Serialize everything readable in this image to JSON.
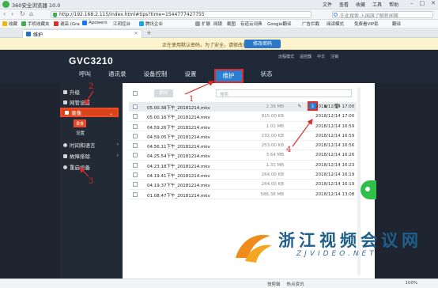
{
  "browser": {
    "title": "360安全浏览器 10.0",
    "menus": [
      "文件",
      "查看",
      "收藏",
      "工具",
      "帮助"
    ],
    "url": "http://192.168.2.115/index.html#tips?time=1544777427755",
    "search_placeholder": "在此搜索 入国旗了解新闻嘛",
    "bookmarks": [
      "收藏",
      "手机收藏夹",
      "谢高 (Gra",
      "Apowers",
      "江玥控台",
      "腾讯企业",
      "扩展",
      "网银",
      "截图",
      "有道云词典",
      "Google翻译",
      "广告拦截",
      "阅读模式",
      "免费看VIP影",
      "翻译"
    ],
    "tab_title": "维护"
  },
  "notice": {
    "message": "正在使用默认密码，为了安全，请修改密码。",
    "button": "修改密码"
  },
  "header": {
    "brand": "GVC3210",
    "top_links": [
      "远程模式",
      "遥控器",
      "中文",
      "注销"
    ],
    "nav": [
      "呼叫",
      "通讯录",
      "设备控制",
      "设置",
      "维护",
      "状态"
    ]
  },
  "sidebar": {
    "items": [
      "升级",
      "网管设置",
      "录像",
      "时间和语言",
      "故障排除",
      "重启设备"
    ],
    "sub_items": [
      "录像",
      "设置"
    ]
  },
  "recordings": {
    "delete_label": "删除",
    "search_placeholder": "搜索",
    "rows": [
      {
        "name": "05.00.38下午_20181214.mkv",
        "size": "2.39 MB",
        "time": "2018/12/14 17:00"
      },
      {
        "name": "05.00.16下午_20181214.mkv",
        "size": "915.00 KB",
        "time": "2018/12/14 17:00"
      },
      {
        "name": "04.59.26下午_20181214.mkv",
        "size": "1.01 MB",
        "time": "2018/12/14 16:59"
      },
      {
        "name": "04.59.05下午_20181214.mkv",
        "size": "232.00 KB",
        "time": "2018/12/14 16:59"
      },
      {
        "name": "04.56.11下午_20181214.mkv",
        "size": "253.00 KB",
        "time": "2018/12/14 16:56"
      },
      {
        "name": "04.25.54下午_20181214.mkv",
        "size": "3.64 MB",
        "time": "2018/12/14 16:26"
      },
      {
        "name": "04.23.18下午_20181214.mkv",
        "size": "1.31 MB",
        "time": "2018/12/14 16:23"
      },
      {
        "name": "04.19.41下午_20181214.mkv",
        "size": "264.00 KB",
        "time": "2018/12/14 16:19"
      },
      {
        "name": "04.19.37下午_20181214.mkv",
        "size": "264.00 KB",
        "time": "2018/12/14 16:19"
      },
      {
        "name": "01.08.47下午_20181214.mkv",
        "size": "586.38 MB",
        "time": "2018/12/14 13:08"
      }
    ]
  },
  "annotations": [
    "1",
    "2",
    "3",
    "4"
  ],
  "watermark": {
    "cn": "浙江视频会议网",
    "en": "ZJVIDEO.NET"
  },
  "statusbar": [
    "快剪辑",
    "热点资讯",
    "100%"
  ],
  "colors": {
    "header_bg": "#1f2937",
    "nav_active": "#2a7fd0",
    "sidebar_selected": "#d9451b",
    "annotation_red": "#e02b2b",
    "notice_bg": "#fdf3cd"
  }
}
